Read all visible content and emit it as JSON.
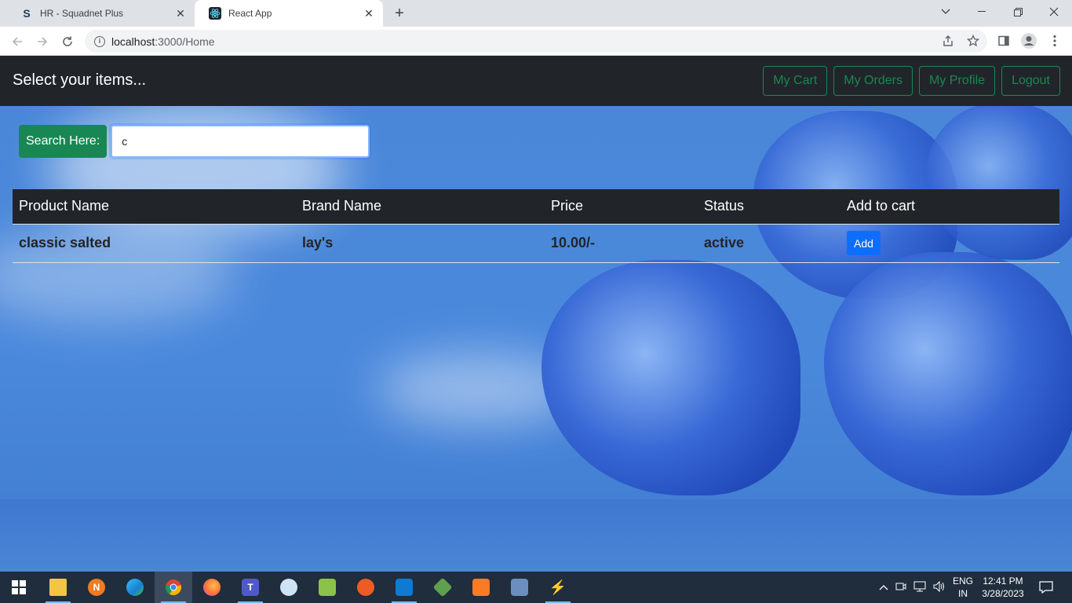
{
  "browser": {
    "tabs": [
      {
        "title": "HR - Squadnet Plus",
        "favicon": "S"
      },
      {
        "title": "React App",
        "favicon": "react-logo"
      }
    ],
    "new_tab_symbol": "+",
    "url_host": "localhost",
    "url_rest": ":3000/Home"
  },
  "app": {
    "brand": "Select your items...",
    "nav": {
      "cart": "My Cart",
      "orders": "My Orders",
      "profile": "My Profile",
      "logout": "Logout"
    },
    "search": {
      "label": "Search Here:",
      "value": "c"
    },
    "table": {
      "headers": [
        "Product Name",
        "Brand Name",
        "Price",
        "Status",
        "Add to cart"
      ],
      "rows": [
        {
          "product": "classic salted",
          "brand": "lay's",
          "price": "10.00/-",
          "status": "active",
          "action": "Add"
        }
      ]
    },
    "colors": {
      "navbar": "#212529",
      "success": "#198754",
      "primary": "#0d6efd"
    }
  },
  "taskbar": {
    "lang_top": "ENG",
    "lang_bottom": "IN",
    "time": "12:41 PM",
    "date": "3/28/2023"
  }
}
